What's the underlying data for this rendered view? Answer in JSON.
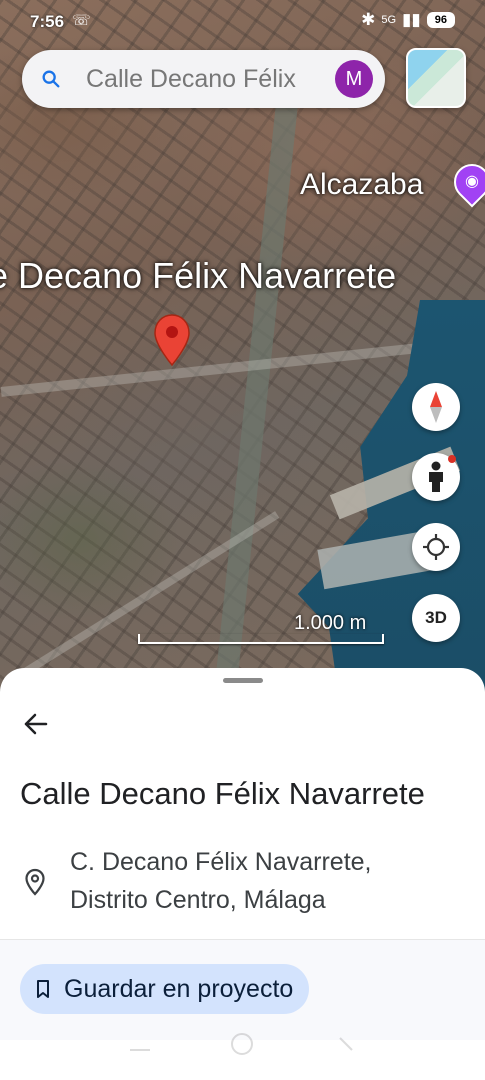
{
  "status_bar": {
    "time": "7:56",
    "network": "5G",
    "battery": "96"
  },
  "search": {
    "query": "Calle Decano Félix",
    "avatar_initial": "M"
  },
  "map": {
    "street_label": "e Decano Félix Navarrete",
    "poi_label": "Alcazaba",
    "scale_label": "1.000 m",
    "threed_label": "3D"
  },
  "place": {
    "title": "Calle Decano Félix Navarrete",
    "address_line1": "C. Decano Félix Navarrete,",
    "address_line2": "Distrito Centro, Málaga",
    "save_button_label": "Guardar en proyecto"
  },
  "icons": {
    "search": "search-icon",
    "layers": "layers-icon",
    "compass": "compass-icon",
    "street_view": "pegman-icon",
    "locate": "my-location-icon",
    "back": "arrow-back-icon",
    "location": "location-pin-icon",
    "bookmark": "bookmark-icon",
    "poi": "camera-icon"
  },
  "colors": {
    "pin": "#ea4335",
    "avatar": "#8e24aa",
    "save_button_bg": "#d3e3fd",
    "poi": "#a142f4"
  }
}
